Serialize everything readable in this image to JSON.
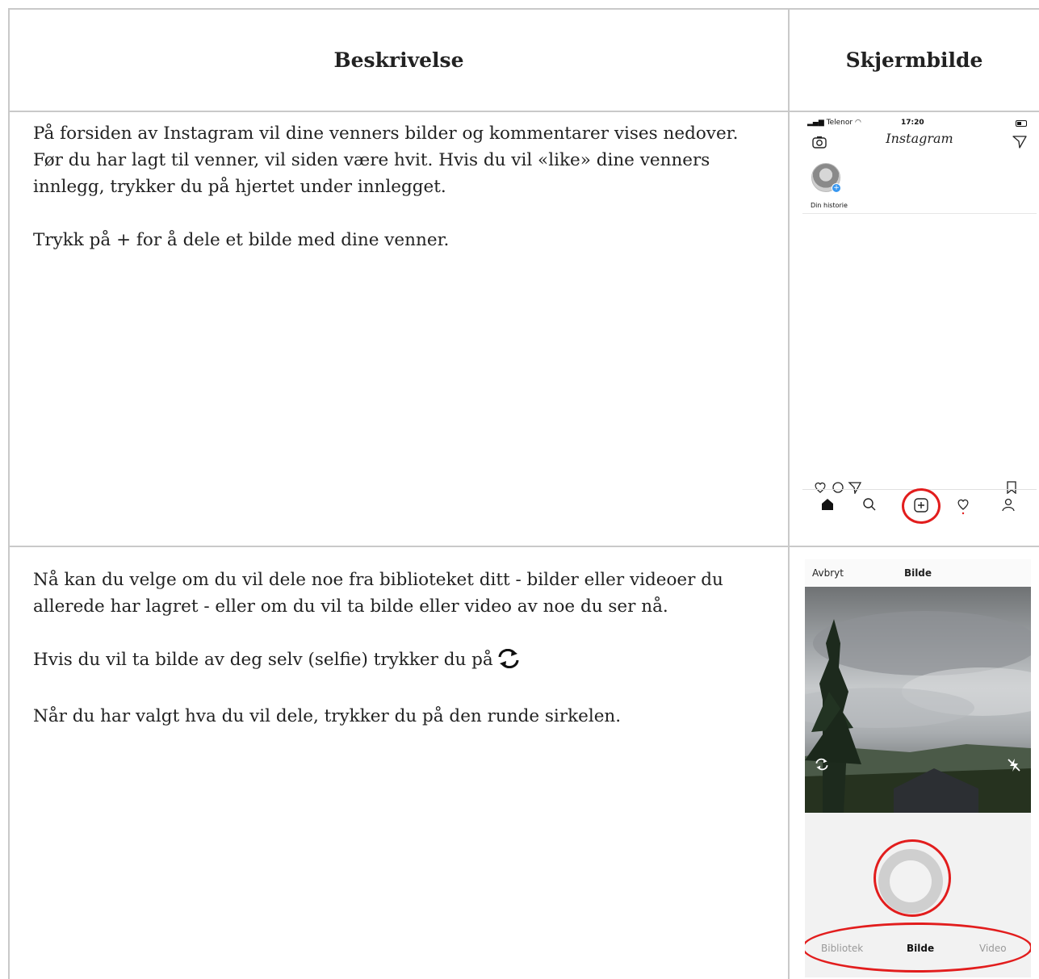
{
  "table": {
    "headers": [
      "Beskrivelse",
      "Skjermbilde"
    ],
    "rows": [
      {
        "paragraphs": [
          "På forsiden av Instagram vil dine venners bilder og kommentarer vises nedover. Før du har lagt til venner, vil siden være hvit. Hvis du vil «like» dine venners innlegg, trykker du på hjertet under innlegget.",
          "Trykk på + for å dele et bilde med dine venner."
        ]
      },
      {
        "paragraphs": [
          "Nå kan du velge om du vil dele noe fra biblioteket ditt - bilder eller videoer du allerede har lagret - eller om du vil ta bilde eller video av noe du ser nå.",
          "Hvis du vil ta bilde av deg selv (selfie) trykker du på",
          "Når du har valgt hva du vil dele, trykker du på den runde sirkelen."
        ]
      }
    ]
  },
  "screen1": {
    "carrier": "Telenor",
    "time": "17:20",
    "app_title": "Instagram",
    "story_label": "Din historie",
    "icons": [
      "camera-icon",
      "send-icon",
      "heart-icon",
      "comment-icon",
      "share-icon",
      "bookmark-icon",
      "home-icon",
      "search-icon",
      "plus-icon",
      "activity-heart-icon",
      "profile-icon"
    ],
    "highlight_color": "#e21d1d"
  },
  "screen2": {
    "cancel": "Avbryt",
    "title": "Bilde",
    "tabs": [
      "Bibliotek",
      "Bilde",
      "Video"
    ],
    "icons": [
      "camera-flip-icon",
      "flash-off-icon",
      "shutter-button"
    ]
  }
}
